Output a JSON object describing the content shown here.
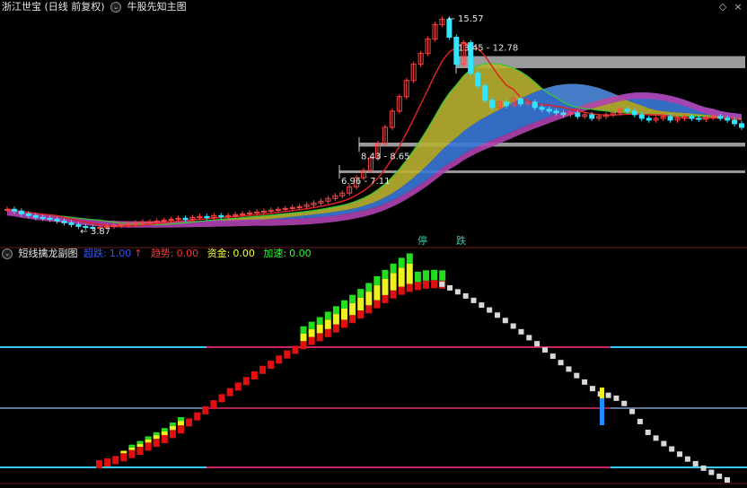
{
  "main_header": {
    "stock_title": "浙江世宝 (日线 前复权)",
    "indicator_name": "牛股先知主图",
    "colors": {
      "text": "#e6e6e6"
    }
  },
  "main_annotations": {
    "high_price": "15.57",
    "low_price": "3.87",
    "resist_band_1": "13.45 - 12.78",
    "resist_band_2": "8.43 - 8.65",
    "resist_band_3": "6.96 - 7.11",
    "signal_stop": "停",
    "signal_fall": "跌"
  },
  "sub_header": {
    "indicator_name": "短线擒龙副图",
    "metrics": [
      {
        "label": "超跌:",
        "value": "1.00",
        "color": "#3355ff"
      },
      {
        "label": "趋势:",
        "value": "0.00",
        "color": "#ff3333"
      },
      {
        "label": "资金:",
        "value": "0.00",
        "color": "#ffff33"
      },
      {
        "label": "加速:",
        "value": "0.00",
        "color": "#33ff33"
      }
    ],
    "arrow_icon": "↑"
  },
  "colors": {
    "up_candle": "#ff4444",
    "down_candle": "#33e5ff",
    "ma_short": "#dd2222",
    "ma_mid": "#33cc33",
    "ribbon_yellow": "#b8b030",
    "ribbon_blue": "#3a78d8",
    "ribbon_magenta": "#b040b0",
    "resist_box": "#9a9a9a",
    "cyan_line": "#33ccee",
    "magenta_line": "#cc2266",
    "separator": "#6a1a1a"
  },
  "chart_data": [
    {
      "type": "candlestick",
      "title": "浙江世宝 (日线 前复权)",
      "annotations": {
        "max": 15.57,
        "min": 3.87
      },
      "resistance_bands": [
        [
          12.78,
          13.45
        ],
        [
          8.43,
          8.65
        ],
        [
          6.96,
          7.11
        ]
      ],
      "close": [
        4.95,
        4.85,
        4.7,
        4.6,
        4.5,
        4.45,
        4.4,
        4.3,
        4.2,
        4.1,
        4.0,
        3.95,
        3.9,
        3.95,
        4.0,
        4.05,
        4.1,
        4.15,
        4.2,
        4.25,
        4.25,
        4.3,
        4.35,
        4.4,
        4.45,
        4.4,
        4.5,
        4.55,
        4.5,
        4.6,
        4.55,
        4.6,
        4.65,
        4.7,
        4.75,
        4.8,
        4.85,
        4.9,
        4.95,
        5.0,
        5.05,
        5.1,
        5.2,
        5.3,
        5.4,
        5.55,
        5.7,
        5.85,
        6.2,
        6.7,
        7.1,
        7.8,
        8.6,
        9.5,
        10.4,
        11.2,
        12.1,
        13.0,
        13.6,
        14.4,
        15.2,
        15.5,
        14.5,
        13.0,
        14.2,
        12.5,
        11.8,
        11.0,
        10.6,
        10.9,
        10.7,
        11.1,
        10.8,
        10.9,
        10.6,
        10.5,
        10.4,
        10.3,
        10.2,
        10.3,
        10.1,
        10.2,
        10.0,
        10.1,
        10.2,
        10.3,
        10.5,
        10.4,
        10.2,
        10.0,
        9.9,
        10.0,
        10.1,
        9.9,
        10.0,
        10.1,
        10.0,
        9.95,
        10.05,
        10.1,
        10.0,
        9.9,
        9.7,
        9.5
      ]
    },
    {
      "type": "bar",
      "title": "短线擒龙副图",
      "legend": [
        "超跌",
        "趋势",
        "资金",
        "加速"
      ],
      "values": [
        {
          "x": 23,
          "r": 5.0,
          "y": 0,
          "g": 0
        },
        {
          "x": 24,
          "r": 5.4,
          "y": 0,
          "g": 0
        },
        {
          "x": 25,
          "r": 5.9,
          "y": 0,
          "g": 0
        },
        {
          "x": 26,
          "r": 6.5,
          "y": 0.6,
          "g": 0
        },
        {
          "x": 27,
          "r": 7.2,
          "y": 0.6,
          "g": 0.7
        },
        {
          "x": 28,
          "r": 7.9,
          "y": 0.7,
          "g": 0.7
        },
        {
          "x": 29,
          "r": 8.8,
          "y": 0.8,
          "g": 0.7
        },
        {
          "x": 30,
          "r": 9.6,
          "y": 0.9,
          "g": 0.7
        },
        {
          "x": 31,
          "r": 10.4,
          "y": 0.9,
          "g": 0.8
        },
        {
          "x": 32,
          "r": 11.5,
          "y": 1.0,
          "g": 0.8
        },
        {
          "x": 33,
          "r": 12.5,
          "y": 1.1,
          "g": 0.9
        },
        {
          "x": 34,
          "r": 14.0,
          "y": 0,
          "g": 0
        },
        {
          "x": 35,
          "r": 15.3,
          "y": 0,
          "g": 0
        },
        {
          "x": 36,
          "r": 16.6,
          "y": 0,
          "g": 0
        },
        {
          "x": 37,
          "r": 17.9,
          "y": 0,
          "g": 0
        },
        {
          "x": 38,
          "r": 19.2,
          "y": 0,
          "g": 0
        },
        {
          "x": 39,
          "r": 20.5,
          "y": 0,
          "g": 0
        },
        {
          "x": 40,
          "r": 21.7,
          "y": 0,
          "g": 0
        },
        {
          "x": 41,
          "r": 22.9,
          "y": 0,
          "g": 0
        },
        {
          "x": 42,
          "r": 24.1,
          "y": 0,
          "g": 0
        },
        {
          "x": 43,
          "r": 25.3,
          "y": 0,
          "g": 0
        },
        {
          "x": 44,
          "r": 26.4,
          "y": 0,
          "g": 0
        },
        {
          "x": 45,
          "r": 27.5,
          "y": 0,
          "g": 0
        },
        {
          "x": 46,
          "r": 28.6,
          "y": 0,
          "g": 0
        },
        {
          "x": 47,
          "r": 29.6,
          "y": 0,
          "g": 0
        },
        {
          "x": 48,
          "r": 30.6,
          "y": 1.8,
          "g": 1.8
        },
        {
          "x": 49,
          "r": 31.5,
          "y": 1.9,
          "g": 1.8
        },
        {
          "x": 50,
          "r": 32.3,
          "y": 2.1,
          "g": 1.8
        },
        {
          "x": 51,
          "r": 33.2,
          "y": 2.3,
          "g": 1.9
        },
        {
          "x": 52,
          "r": 34.2,
          "y": 2.5,
          "g": 1.9
        },
        {
          "x": 53,
          "r": 35.2,
          "y": 2.7,
          "g": 2.0
        },
        {
          "x": 54,
          "r": 36.2,
          "y": 2.9,
          "g": 2.0
        },
        {
          "x": 55,
          "r": 37.2,
          "y": 3.1,
          "g": 2.1
        },
        {
          "x": 56,
          "r": 38.3,
          "y": 3.3,
          "g": 2.1
        },
        {
          "x": 57,
          "r": 39.4,
          "y": 3.6,
          "g": 2.2
        },
        {
          "x": 58,
          "r": 40.5,
          "y": 3.9,
          "g": 2.2
        },
        {
          "x": 59,
          "r": 41.5,
          "y": 4.2,
          "g": 2.3
        },
        {
          "x": 60,
          "r": 42.3,
          "y": 4.6,
          "g": 2.4
        },
        {
          "x": 61,
          "r": 42.9,
          "y": 4.9,
          "g": 2.5
        },
        {
          "x": 62,
          "r": 43.3,
          "y": 0,
          "g": 2.5
        },
        {
          "x": 63,
          "r": 43.6,
          "y": 0,
          "g": 2.5
        },
        {
          "x": 64,
          "r": 43.7,
          "y": 0,
          "g": 2.5
        },
        {
          "x": 65,
          "r": 43.6,
          "y": 0,
          "g": 2.5
        }
      ]
    }
  ]
}
